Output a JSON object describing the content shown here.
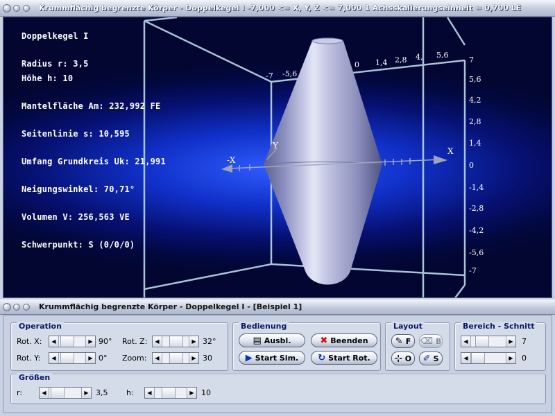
{
  "window": {
    "title": "Krummflächig begrenzte Körper - Doppelkegel I   -7,000 <= X, Y, Z <= 7,000    1 Achsskalierungseinheit = 0,700 LE"
  },
  "info": {
    "heading": "Doppelkegel I",
    "radius": "Radius r: 3,5",
    "hoehe": "Höhe h: 10",
    "mantel": "Mantelfläche Am: 232,992 FE",
    "seitenlinie": "Seitenlinie s: 10,595",
    "umfang": "Umfang Grundkreis Uk: 21,991",
    "neigung": "Neigungswinkel: 70,71°",
    "volumen": "Volumen V: 256,563 VE",
    "schwerpunkt": "Schwerpunkt: S (0/0/0)"
  },
  "axes": {
    "x_label": "X",
    "neg_x_label": "-X",
    "y_label": "Y",
    "z_ticks": [
      "7",
      "5,6",
      "4,2",
      "2,8",
      "1,4",
      "0",
      "-1,4",
      "-2,8",
      "-4,2",
      "-5,6",
      "-7"
    ],
    "top_ticks": [
      "-7",
      "-5,6",
      "0",
      "1,4",
      "2,8",
      "4,",
      "5,6",
      "7"
    ]
  },
  "subwindow": {
    "title": "Krummflächig begrenzte Körper - Doppelkegel I - [Beispiel 1]"
  },
  "operation": {
    "title": "Operation",
    "rot_x_label": "Rot. X:",
    "rot_x_value": "90°",
    "rot_y_label": "Rot. Y:",
    "rot_y_value": "0°",
    "rot_z_label": "Rot. Z:",
    "rot_z_value": "32°",
    "zoom_label": "Zoom:",
    "zoom_value": "30"
  },
  "bedienung": {
    "title": "Bedienung",
    "ausbl": "Ausbl.",
    "beenden": "Beenden",
    "start_sim": "Start Sim.",
    "start_rot": "Start Rot."
  },
  "layout": {
    "title": "Layout",
    "f": "F",
    "b": "B",
    "o": "O",
    "s": "S"
  },
  "bereich": {
    "title": "Bereich - Schnitt",
    "value1": "7",
    "value2": "0"
  },
  "groessen": {
    "title": "Größen",
    "r_label": "r:",
    "r_value": "3,5",
    "h_label": "h:",
    "h_value": "10"
  },
  "colors": {
    "viewport_center": "#2f5dff",
    "viewport_edge": "#020630",
    "solid": "#b4b8dc",
    "frame": "#a9c3d6"
  }
}
